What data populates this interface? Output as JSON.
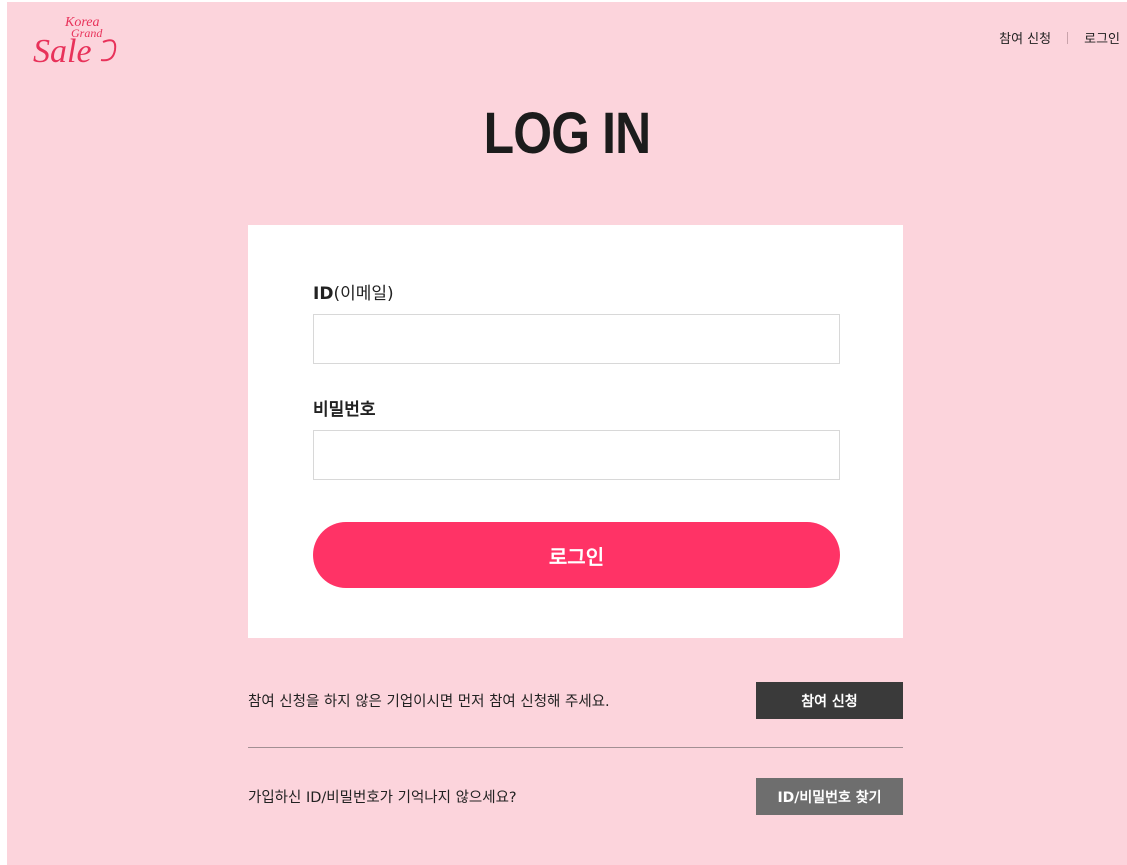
{
  "brand": {
    "logo_line1": "Korea",
    "logo_line2": "Grand",
    "logo_line3": "Sale",
    "color": "#e8325a"
  },
  "topnav": {
    "join": "참여 신청",
    "login": "로그인"
  },
  "page_title": "LOG IN",
  "form": {
    "id_label_strong": "ID",
    "id_label_rest": "(이메일)",
    "id_value": "",
    "password_label": "비밀번호",
    "password_value": "",
    "submit_label": "로그인"
  },
  "join_row": {
    "text": "참여 신청을 하지 않은 기업이시면 먼저 참여 신청해 주세요.",
    "button": "참여 신청"
  },
  "find_row": {
    "text": "가입하신 ID/비밀번호가 기억나지 않으세요?",
    "button": "ID/비밀번호 찾기"
  },
  "colors": {
    "background": "#fcd4dc",
    "accent": "#ff3366",
    "dark_button": "#3a3a3a",
    "gray_button": "#6e6e6e"
  }
}
